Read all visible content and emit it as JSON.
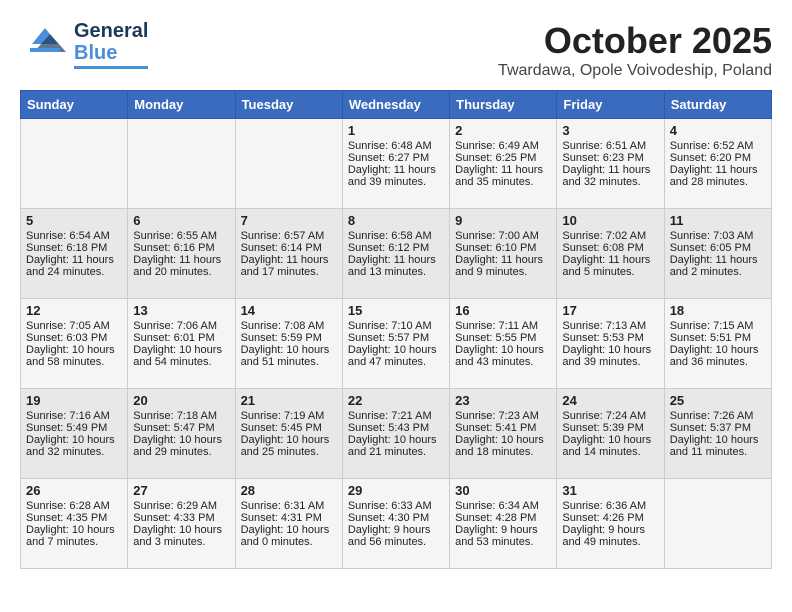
{
  "header": {
    "logo_general": "General",
    "logo_blue": "Blue",
    "title": "October 2025",
    "subtitle": "Twardawa, Opole Voivodeship, Poland"
  },
  "weekdays": [
    "Sunday",
    "Monday",
    "Tuesday",
    "Wednesday",
    "Thursday",
    "Friday",
    "Saturday"
  ],
  "weeks": [
    [
      {
        "day": "",
        "text": ""
      },
      {
        "day": "",
        "text": ""
      },
      {
        "day": "",
        "text": ""
      },
      {
        "day": "1",
        "text": "Sunrise: 6:48 AM\nSunset: 6:27 PM\nDaylight: 11 hours\nand 39 minutes."
      },
      {
        "day": "2",
        "text": "Sunrise: 6:49 AM\nSunset: 6:25 PM\nDaylight: 11 hours\nand 35 minutes."
      },
      {
        "day": "3",
        "text": "Sunrise: 6:51 AM\nSunset: 6:23 PM\nDaylight: 11 hours\nand 32 minutes."
      },
      {
        "day": "4",
        "text": "Sunrise: 6:52 AM\nSunset: 6:20 PM\nDaylight: 11 hours\nand 28 minutes."
      }
    ],
    [
      {
        "day": "5",
        "text": "Sunrise: 6:54 AM\nSunset: 6:18 PM\nDaylight: 11 hours\nand 24 minutes."
      },
      {
        "day": "6",
        "text": "Sunrise: 6:55 AM\nSunset: 6:16 PM\nDaylight: 11 hours\nand 20 minutes."
      },
      {
        "day": "7",
        "text": "Sunrise: 6:57 AM\nSunset: 6:14 PM\nDaylight: 11 hours\nand 17 minutes."
      },
      {
        "day": "8",
        "text": "Sunrise: 6:58 AM\nSunset: 6:12 PM\nDaylight: 11 hours\nand 13 minutes."
      },
      {
        "day": "9",
        "text": "Sunrise: 7:00 AM\nSunset: 6:10 PM\nDaylight: 11 hours\nand 9 minutes."
      },
      {
        "day": "10",
        "text": "Sunrise: 7:02 AM\nSunset: 6:08 PM\nDaylight: 11 hours\nand 5 minutes."
      },
      {
        "day": "11",
        "text": "Sunrise: 7:03 AM\nSunset: 6:05 PM\nDaylight: 11 hours\nand 2 minutes."
      }
    ],
    [
      {
        "day": "12",
        "text": "Sunrise: 7:05 AM\nSunset: 6:03 PM\nDaylight: 10 hours\nand 58 minutes."
      },
      {
        "day": "13",
        "text": "Sunrise: 7:06 AM\nSunset: 6:01 PM\nDaylight: 10 hours\nand 54 minutes."
      },
      {
        "day": "14",
        "text": "Sunrise: 7:08 AM\nSunset: 5:59 PM\nDaylight: 10 hours\nand 51 minutes."
      },
      {
        "day": "15",
        "text": "Sunrise: 7:10 AM\nSunset: 5:57 PM\nDaylight: 10 hours\nand 47 minutes."
      },
      {
        "day": "16",
        "text": "Sunrise: 7:11 AM\nSunset: 5:55 PM\nDaylight: 10 hours\nand 43 minutes."
      },
      {
        "day": "17",
        "text": "Sunrise: 7:13 AM\nSunset: 5:53 PM\nDaylight: 10 hours\nand 39 minutes."
      },
      {
        "day": "18",
        "text": "Sunrise: 7:15 AM\nSunset: 5:51 PM\nDaylight: 10 hours\nand 36 minutes."
      }
    ],
    [
      {
        "day": "19",
        "text": "Sunrise: 7:16 AM\nSunset: 5:49 PM\nDaylight: 10 hours\nand 32 minutes."
      },
      {
        "day": "20",
        "text": "Sunrise: 7:18 AM\nSunset: 5:47 PM\nDaylight: 10 hours\nand 29 minutes."
      },
      {
        "day": "21",
        "text": "Sunrise: 7:19 AM\nSunset: 5:45 PM\nDaylight: 10 hours\nand 25 minutes."
      },
      {
        "day": "22",
        "text": "Sunrise: 7:21 AM\nSunset: 5:43 PM\nDaylight: 10 hours\nand 21 minutes."
      },
      {
        "day": "23",
        "text": "Sunrise: 7:23 AM\nSunset: 5:41 PM\nDaylight: 10 hours\nand 18 minutes."
      },
      {
        "day": "24",
        "text": "Sunrise: 7:24 AM\nSunset: 5:39 PM\nDaylight: 10 hours\nand 14 minutes."
      },
      {
        "day": "25",
        "text": "Sunrise: 7:26 AM\nSunset: 5:37 PM\nDaylight: 10 hours\nand 11 minutes."
      }
    ],
    [
      {
        "day": "26",
        "text": "Sunrise: 6:28 AM\nSunset: 4:35 PM\nDaylight: 10 hours\nand 7 minutes."
      },
      {
        "day": "27",
        "text": "Sunrise: 6:29 AM\nSunset: 4:33 PM\nDaylight: 10 hours\nand 3 minutes."
      },
      {
        "day": "28",
        "text": "Sunrise: 6:31 AM\nSunset: 4:31 PM\nDaylight: 10 hours\nand 0 minutes."
      },
      {
        "day": "29",
        "text": "Sunrise: 6:33 AM\nSunset: 4:30 PM\nDaylight: 9 hours\nand 56 minutes."
      },
      {
        "day": "30",
        "text": "Sunrise: 6:34 AM\nSunset: 4:28 PM\nDaylight: 9 hours\nand 53 minutes."
      },
      {
        "day": "31",
        "text": "Sunrise: 6:36 AM\nSunset: 4:26 PM\nDaylight: 9 hours\nand 49 minutes."
      },
      {
        "day": "",
        "text": ""
      }
    ]
  ]
}
